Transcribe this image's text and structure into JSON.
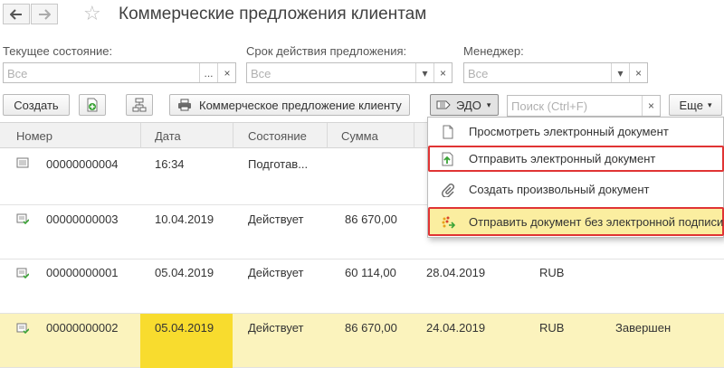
{
  "header": {
    "title": "Коммерческие предложения клиентам"
  },
  "filters": {
    "state": {
      "label": "Текущее состояние:",
      "placeholder": "Все"
    },
    "period": {
      "label": "Срок действия предложения:",
      "placeholder": "Все"
    },
    "manager": {
      "label": "Менеджер:",
      "placeholder": "Все"
    }
  },
  "toolbar": {
    "create": "Создать",
    "print_label": "Коммерческое предложение клиенту",
    "edo": "ЭДО",
    "search_placeholder": "Поиск (Ctrl+F)",
    "more": "Еще"
  },
  "table": {
    "columns": [
      "Номер",
      "Дата",
      "Состояние",
      "Сумма"
    ],
    "rows": [
      {
        "number": "00000000004",
        "date": "16:34",
        "state": "Подготав...",
        "sum": "",
        "valid": "",
        "currency": "",
        "status": ""
      },
      {
        "number": "00000000003",
        "date": "10.04.2019",
        "state": "Действует",
        "sum": "86 670,00",
        "valid": "",
        "currency": "",
        "status": ""
      },
      {
        "number": "00000000001",
        "date": "05.04.2019",
        "state": "Действует",
        "sum": "60 114,00",
        "valid": "28.04.2019",
        "currency": "RUB",
        "status": ""
      },
      {
        "number": "00000000002",
        "date": "05.04.2019",
        "state": "Действует",
        "sum": "86 670,00",
        "valid": "24.04.2019",
        "currency": "RUB",
        "status": "Завершен"
      }
    ]
  },
  "menu": {
    "items": [
      {
        "label": "Просмотреть электронный документ"
      },
      {
        "label": "Отправить электронный документ"
      },
      {
        "label": "Создать произвольный документ"
      },
      {
        "label": "Отправить документ без электронной подписи"
      }
    ]
  },
  "colors": {
    "selected_row": "#fbf3bd",
    "selected_cell": "#f8dc2e",
    "highlight": "#e03434",
    "menu_selected": "#fbeea0"
  }
}
